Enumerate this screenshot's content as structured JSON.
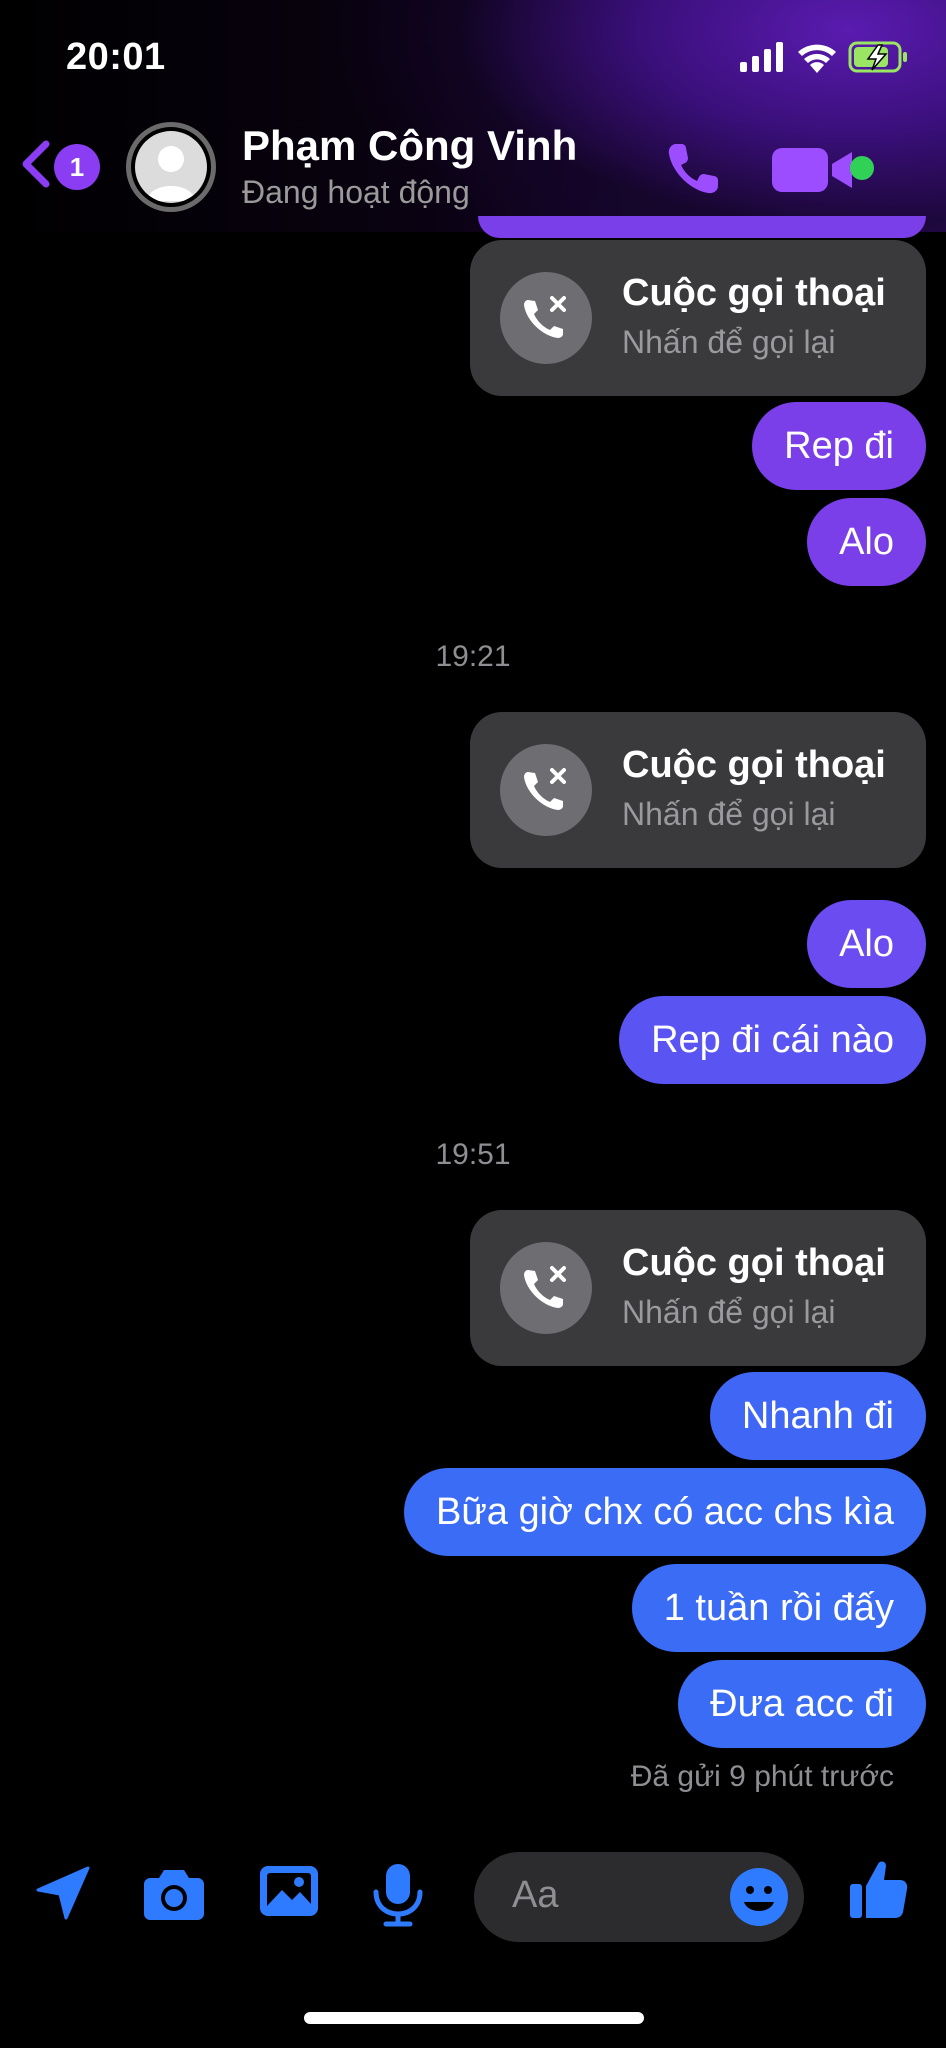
{
  "status_bar": {
    "time": "20:01"
  },
  "header": {
    "unread_badge": "1",
    "contact_name": "Phạm Công Vinh",
    "contact_status": "Đang hoạt động"
  },
  "messages": {
    "call1": {
      "title": "Cuộc gọi thoại",
      "subtitle": "Nhấn để gọi lại"
    },
    "m1": "Rep đi",
    "m2": "Alo",
    "ts1": "19:21",
    "call2": {
      "title": "Cuộc gọi thoại",
      "subtitle": "Nhấn để gọi lại"
    },
    "m3": "Alo",
    "m4": "Rep đi cái nào",
    "ts2": "19:51",
    "call3": {
      "title": "Cuộc gọi thoại",
      "subtitle": "Nhấn để gọi lại"
    },
    "m5": "Nhanh đi",
    "m6": "Bữa giờ chx có acc chs kìa",
    "m7": "1 tuần rồi đấy",
    "m8": "Đưa acc đi",
    "seen": "Đã gửi 9 phút trước"
  },
  "composer": {
    "placeholder": "Aa"
  },
  "colors": {
    "accent_purple": "#8a3df2",
    "bubble_purple": "#7a3fe8",
    "bubble_indigo": "#5a55f2",
    "bubble_blue": "#3b6cf5",
    "toolbar_blue": "#2f7bff",
    "online_green": "#31d158"
  },
  "icons": [
    "back-chevron-icon",
    "phone-icon",
    "video-camera-icon",
    "missed-call-icon",
    "location-arrow-icon",
    "camera-icon",
    "image-icon",
    "microphone-icon",
    "emoji-icon",
    "thumbs-up-icon",
    "signal-icon",
    "wifi-icon",
    "battery-icon"
  ]
}
